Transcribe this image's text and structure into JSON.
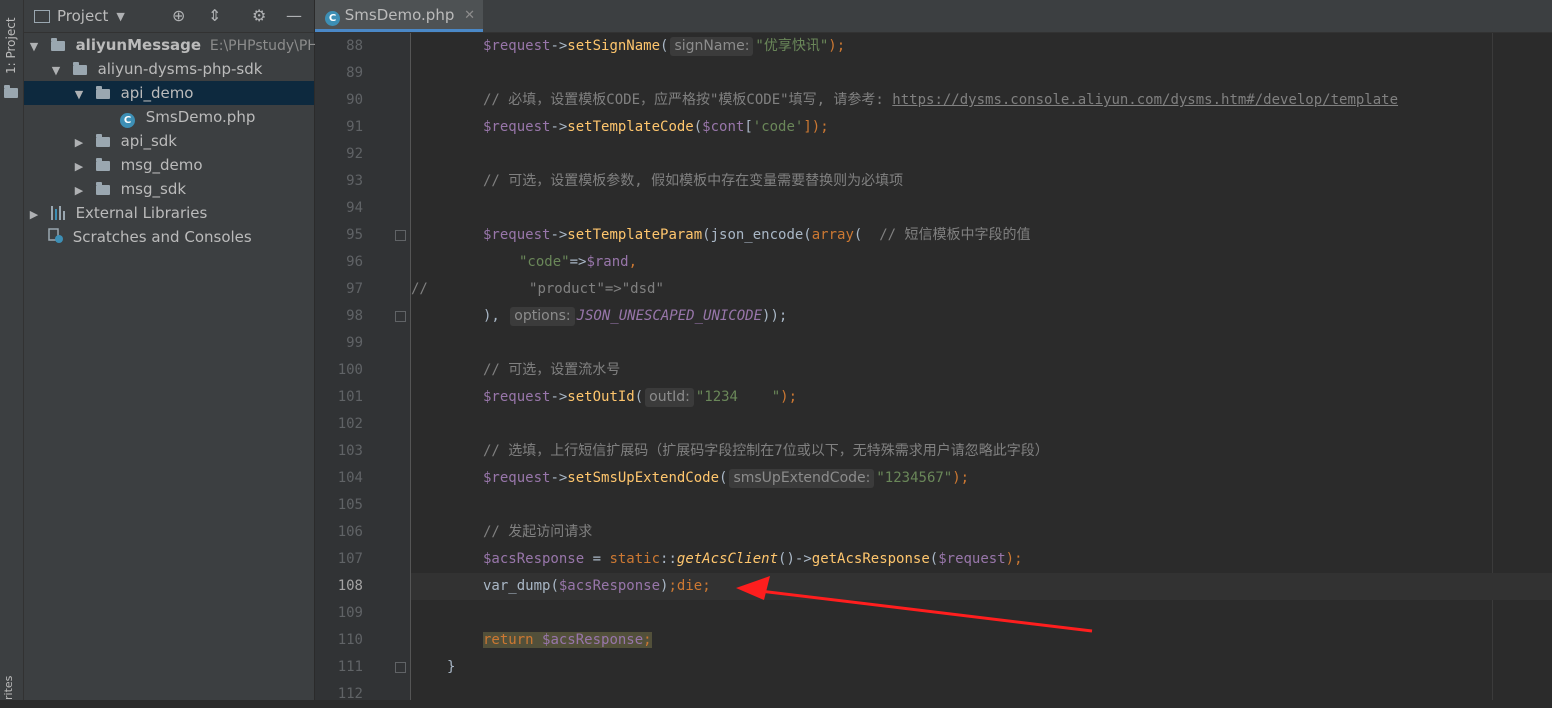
{
  "sidebar_strip": {
    "project_tab": "1: Project",
    "favorites_tab": "rites"
  },
  "project_panel": {
    "title": "Project",
    "root_name": "aliyunMessage",
    "root_path": "E:\\PHPstudy\\PHP",
    "items": [
      {
        "label": "aliyun-dysms-php-sdk"
      },
      {
        "label": "api_demo"
      },
      {
        "label": "SmsDemo.php"
      },
      {
        "label": "api_sdk"
      },
      {
        "label": "msg_demo"
      },
      {
        "label": "msg_sdk"
      },
      {
        "label": "External Libraries"
      },
      {
        "label": "Scratches and Consoles"
      }
    ]
  },
  "editor": {
    "tab_label": "SmsDemo.php",
    "line_numbers": [
      "88",
      "89",
      "90",
      "91",
      "92",
      "93",
      "94",
      "95",
      "96",
      "97",
      "98",
      "99",
      "100",
      "101",
      "102",
      "103",
      "104",
      "105",
      "106",
      "107",
      "108",
      "109",
      "110",
      "111",
      "112"
    ],
    "current_line": "108",
    "code": {
      "l88": {
        "var": "$request",
        "op": "->",
        "fn": "setSignName",
        "open": "(",
        "hint": "signName:",
        "str": "\"优享快讯\"",
        "close": ");"
      },
      "l90": {
        "comment": "// 必填，设置模板CODE，应严格按\"模板CODE\"填写, 请参考: ",
        "url": "https://dysms.console.aliyun.com/dysms.htm#/develop/template"
      },
      "l91": {
        "var": "$request",
        "op": "->",
        "fn": "setTemplateCode",
        "open": "(",
        "var2": "$cont",
        "br": "[",
        "str": "'code'",
        "close": "]);"
      },
      "l93": {
        "comment": "// 可选，设置模板参数, 假如模板中存在变量需要替换则为必填项"
      },
      "l95": {
        "var": "$request",
        "op": "->",
        "fn": "setTemplateParam",
        "open": "(json_encode(",
        "kw": "array",
        "p": "(  ",
        "comment": "// 短信模板中字段的值"
      },
      "l96": {
        "str": "\"code\"",
        "op": "=>",
        "var": "$rand",
        "comma": ","
      },
      "l97": {
        "slashes": "//",
        "str": "\"product\"",
        "op": "=>",
        "str2": "\"dsd\""
      },
      "l98": {
        "close": "),",
        "hint": "options:",
        "const": "JSON_UNESCAPED_UNICODE",
        "end": "));"
      },
      "l100": {
        "comment": "// 可选，设置流水号"
      },
      "l101": {
        "var": "$request",
        "op": "->",
        "fn": "setOutId",
        "open": "(",
        "hint": "outId:",
        "str": "\"1234    \"",
        "close": ");"
      },
      "l103": {
        "comment": "// 选填，上行短信扩展码（扩展码字段控制在7位或以下，无特殊需求用户请忽略此字段）"
      },
      "l104": {
        "var": "$request",
        "op": "->",
        "fn": "setSmsUpExtendCode",
        "open": "(",
        "hint": "smsUpExtendCode:",
        "str": "\"1234567\"",
        "close": ");"
      },
      "l106": {
        "comment": "// 发起访问请求"
      },
      "l107": {
        "var": "$acsResponse",
        "eq": " = ",
        "kw": "static",
        "dc": "::",
        "sfn": "getAcsClient",
        "mid": "()->",
        "fn": "getAcsResponse",
        "open": "(",
        "var2": "$request",
        "close": ");"
      },
      "l108": {
        "fn": "var_dump",
        "open": "(",
        "var": "$acsResponse",
        "close": ")",
        "semi": ";",
        "kw": "die",
        "semi2": ";"
      },
      "l110": {
        "kw": "return",
        "var": "$acsResponse",
        "semi": ";"
      },
      "l111": {
        "brace": "}"
      }
    }
  },
  "colors": {
    "accent": "#4A88C7",
    "annotation_arrow": "#FF1E1E",
    "background": "#2B2B2B"
  }
}
